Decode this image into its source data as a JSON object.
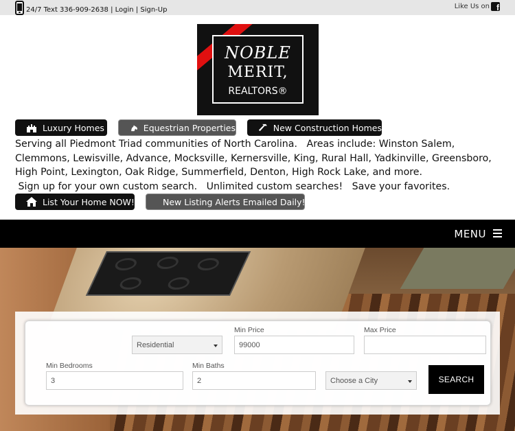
{
  "topbar": {
    "contact_text": "24/7 Text 336-909-2638",
    "sep1": " | ",
    "login_label": "Login",
    "sep2": " | ",
    "signup_label": "Sign-Up",
    "like_us": "Like Us on"
  },
  "logo": {
    "line1": "NOBLE",
    "line2": "MERIT,",
    "line3": "REALTORS®"
  },
  "category_buttons": [
    {
      "label": "Luxury Homes",
      "icon": "castle-icon"
    },
    {
      "label": "Equestrian Properties",
      "icon": "horse-icon"
    },
    {
      "label": "New Construction Homes",
      "icon": "hammer-icon"
    }
  ],
  "intro": {
    "line1": "Serving all Piedmont Triad communities of North Carolina.   Areas include: Winston Salem, Clemmons, Lewisville, Advance, Mocksville, Kernersville, King, Rural Hall, Yadkinville, Greensboro, High Point, Lexington, Oak Ridge, Summerfield, Denton, High Rock Lake, and more.",
    "line2": " Sign up for your own custom search.   Unlimited custom searches!   Save your favorites."
  },
  "cta_buttons": [
    {
      "label": "List Your Home NOW!",
      "icon": "home-icon"
    },
    {
      "label": "New Listing Alerts Emailed Daily!",
      "icon": "envelope-icon"
    }
  ],
  "nav": {
    "menu_label": "MENU"
  },
  "search": {
    "property_type": "Residential",
    "min_price_label": "Min Price",
    "min_price_value": "99000",
    "max_price_label": "Max Price",
    "max_price_value": "",
    "min_bedrooms_label": "Min Bedrooms",
    "min_bedrooms_value": "3",
    "min_baths_label": "Min Baths",
    "min_baths_value": "2",
    "city_placeholder": "Choose a City",
    "search_label": "SEARCH"
  },
  "colors": {
    "button_dark": "#111111",
    "button_gray": "#555555",
    "nav_bg": "#000000",
    "logo_red": "#e01010"
  }
}
